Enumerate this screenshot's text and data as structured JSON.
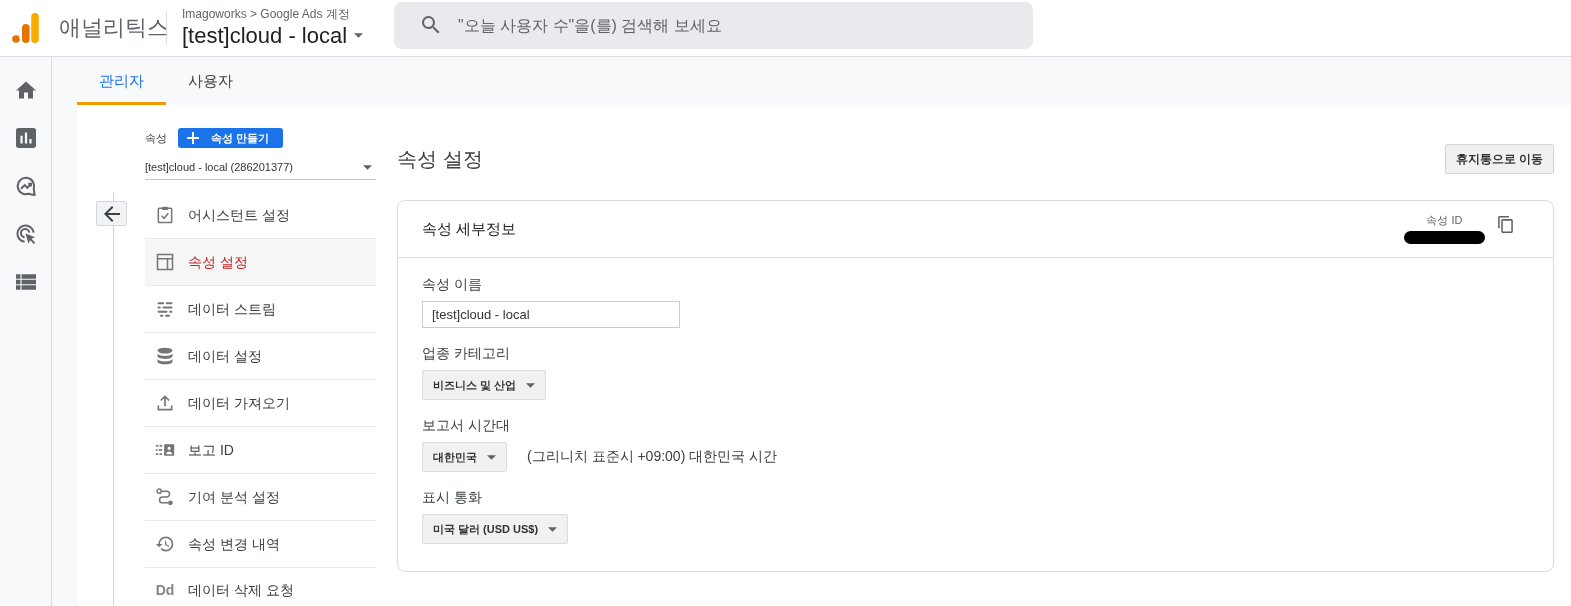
{
  "header": {
    "product_name": "애널리틱스",
    "breadcrumb": "Imagoworks > Google Ads 계정",
    "account_title": "[test]cloud - local",
    "search": {
      "placeholder": "\"오늘 사용자 수\"을(를) 검색해 보세요"
    }
  },
  "tabs": [
    {
      "label": "관리자",
      "selected": true
    },
    {
      "label": "사용자",
      "selected": false
    }
  ],
  "property_nav": {
    "label": "속성",
    "create_button": "속성 만들기",
    "property_selector": "[test]cloud - local (286201377)",
    "items": [
      {
        "label": "어시스턴트 설정",
        "selected": false
      },
      {
        "label": "속성 설정",
        "selected": true
      },
      {
        "label": "데이터 스트림",
        "selected": false
      },
      {
        "label": "데이터 설정",
        "selected": false
      },
      {
        "label": "데이터 가져오기",
        "selected": false
      },
      {
        "label": "보고 ID",
        "selected": false
      },
      {
        "label": "기여 분석 설정",
        "selected": false
      },
      {
        "label": "속성 변경 내역",
        "selected": false
      },
      {
        "label": "데이터 삭제 요청",
        "selected": false,
        "icon_text": "Dd"
      }
    ]
  },
  "page": {
    "title": "속성 설정",
    "trash_button": "휴지통으로 이동"
  },
  "details_card": {
    "title": "속성 세부정보",
    "id_label": "속성 ID",
    "id_redacted": true,
    "fields": [
      {
        "kind": "text_input",
        "label": "속성 이름",
        "value": "[test]cloud - local"
      },
      {
        "kind": "select",
        "label": "업종 카테고리",
        "value": "비즈니스 및 산업"
      },
      {
        "kind": "select",
        "label": "보고서 시간대",
        "value": "대한민국",
        "note": "(그리니치 표준시 +09:00) 대한민국 시간"
      },
      {
        "kind": "select",
        "label": "표시 통화",
        "value": "미국 달러 (USD US$)"
      }
    ]
  }
}
